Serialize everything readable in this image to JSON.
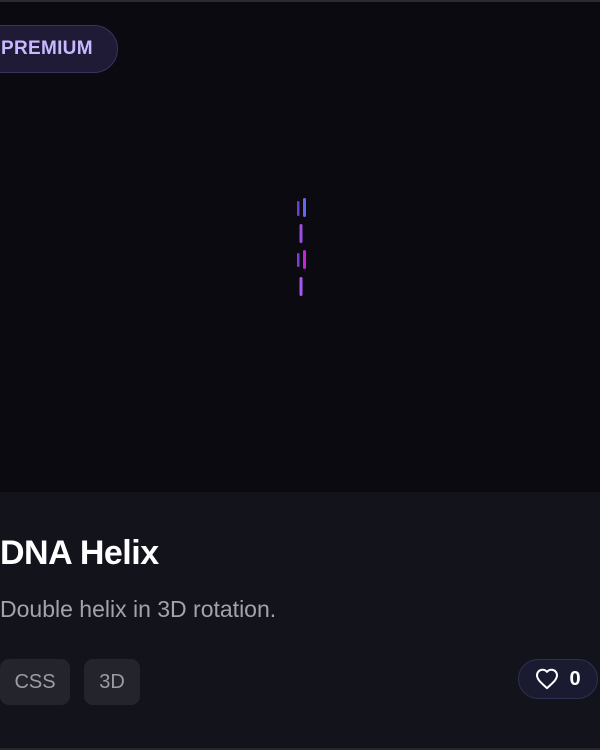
{
  "badge": {
    "label": "PREMIUM"
  },
  "card": {
    "title": "DNA Helix",
    "description": "Double helix in 3D rotation.",
    "tags": [
      "CSS",
      "3D"
    ],
    "likes": "0"
  },
  "icons": {
    "like": "heart-icon"
  },
  "colors": {
    "accent_violet": "#8b5cf6",
    "accent_purple": "#a855f7",
    "accent_magenta": "#c026d3",
    "accent_blue": "#6366f1"
  }
}
